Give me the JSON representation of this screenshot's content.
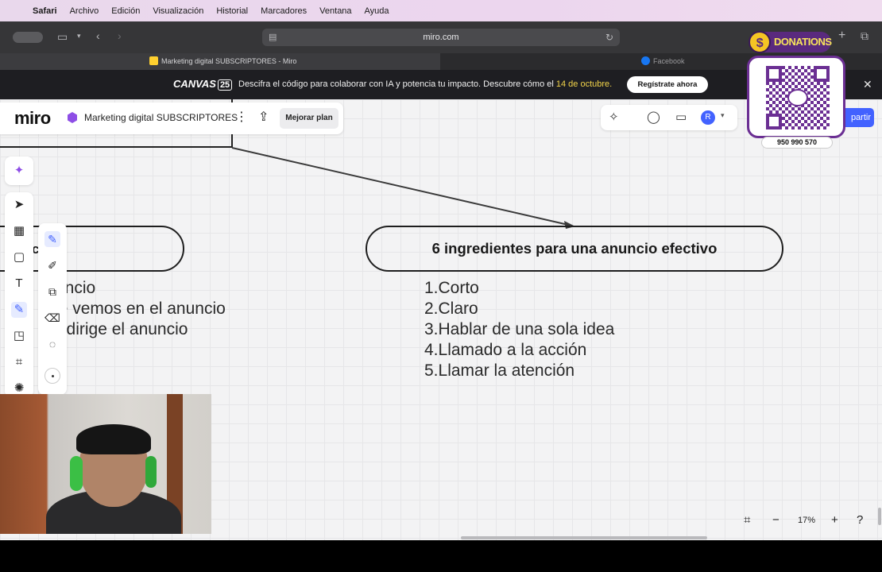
{
  "menubar": {
    "app": "Safari",
    "items": [
      "Archivo",
      "Edición",
      "Visualización",
      "Historial",
      "Marcadores",
      "Ventana",
      "Ayuda"
    ]
  },
  "toolbar": {
    "url": "miro.com"
  },
  "tabs": [
    {
      "label": "Marketing digital SUBSCRIPTORES - Miro",
      "favicon_color": "#ffd02f"
    },
    {
      "label": "Facebook",
      "favicon_color": "#1877f2"
    }
  ],
  "banner": {
    "logo": "CANVAS",
    "logo_num": "25",
    "message": "Descifra el código para colaborar con IA y potencia tu impacto. Descubre cómo el ",
    "date": "14 de octubre.",
    "cta": "Regístrate ahora"
  },
  "miro": {
    "logo": "miro",
    "board_name": "Marketing digital SUBSCRIPTORES",
    "upgrade": "Mejorar plan",
    "avatar": "R",
    "share": "partir"
  },
  "board": {
    "left_pill_text": "c",
    "left_list": [
      "uncio",
      "ue vemos en el anuncio",
      "e dirige el anuncio"
    ],
    "title": "6 ingredientes para una anuncio efectivo",
    "items": [
      "1.Corto",
      "2.Claro",
      "3.Hablar de una sola idea",
      "4.Llamado a la acción",
      "5.Llamar la atención"
    ]
  },
  "zoom": {
    "level": "17%"
  },
  "overlay": {
    "donations": "DONATIONS",
    "phone": "950 990 570"
  },
  "colors": {
    "accent": "#4262ff",
    "miro_purple": "#8e4ee6",
    "yape_purple": "#6b2f93"
  }
}
